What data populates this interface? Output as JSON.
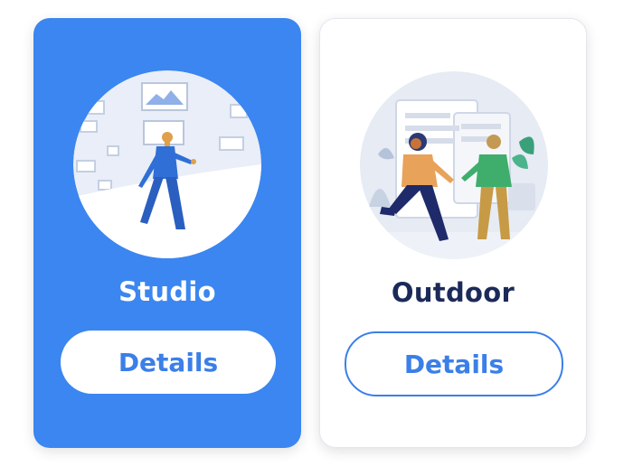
{
  "cards": [
    {
      "title": "Studio",
      "button_label": "Details",
      "selected": true,
      "illustration": "person-walking-in-studio-illustration"
    },
    {
      "title": "Outdoor",
      "button_label": "Details",
      "selected": false,
      "illustration": "two-people-meeting-outdoors-illustration"
    }
  ],
  "colors": {
    "accent": "#3b86f0",
    "title_dark": "#1c2a5a",
    "button_text": "#3b7fe8",
    "card_background": "#ffffff"
  }
}
